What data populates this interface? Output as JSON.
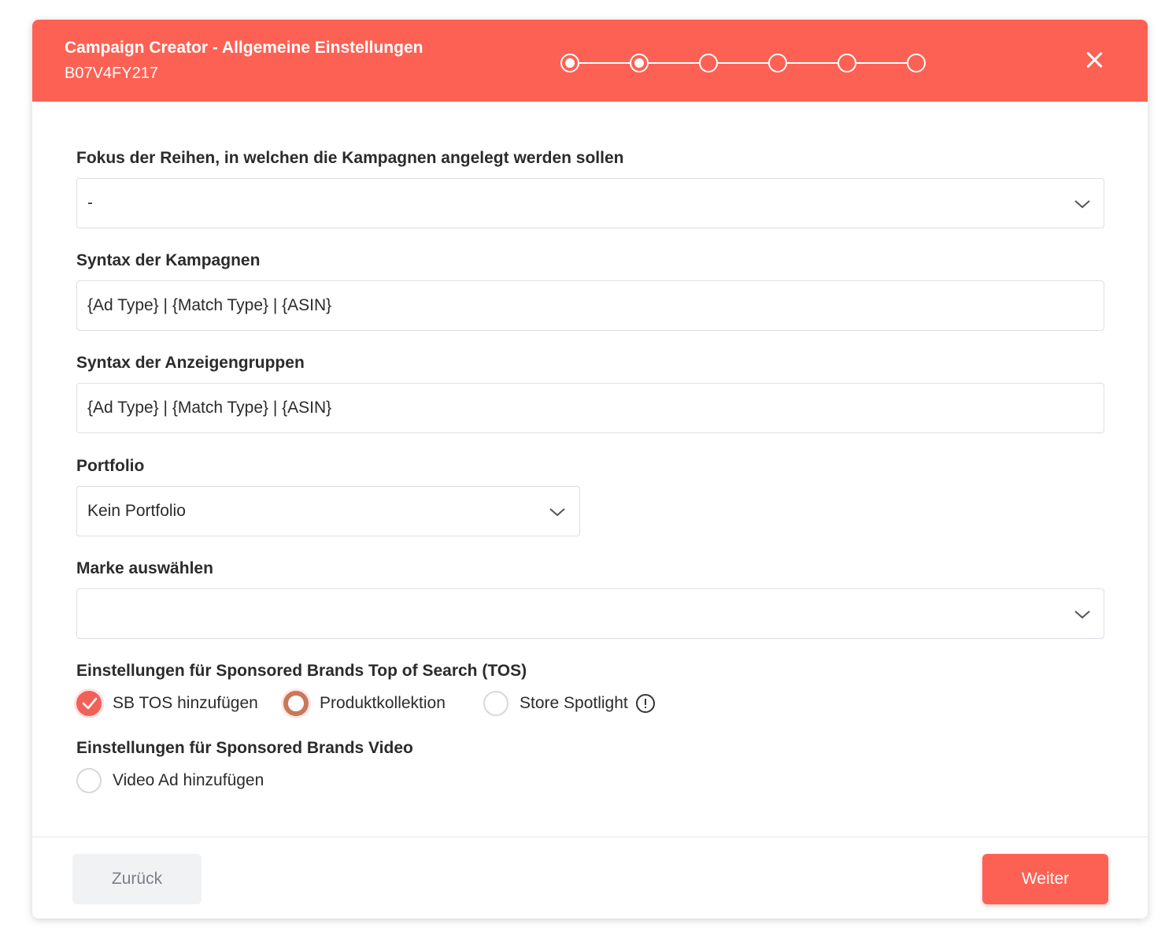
{
  "header": {
    "title": "Campaign Creator - Allgemeine Einstellungen",
    "subtitle": "B07V4FY217",
    "steps_total": 6,
    "steps_completed": 2
  },
  "form": {
    "focus": {
      "label": "Fokus der Reihen, in welchen die Kampagnen angelegt werden sollen",
      "value": "-"
    },
    "campaign_syntax": {
      "label": "Syntax der Kampagnen",
      "value": "{Ad Type} | {Match Type} | {ASIN}"
    },
    "adgroup_syntax": {
      "label": "Syntax der Anzeigengruppen",
      "value": "{Ad Type} | {Match Type} | {ASIN}"
    },
    "portfolio": {
      "label": "Portfolio",
      "value": "Kein Portfolio"
    },
    "brand": {
      "label": "Marke auswählen",
      "value": ""
    },
    "sb_tos": {
      "label": "Einstellungen für Sponsored Brands Top of Search (TOS)",
      "add_label": "SB TOS hinzufügen",
      "add_checked": true,
      "option_collection": "Produktkollektion",
      "option_spotlight": "Store Spotlight",
      "selected": "Produktkollektion"
    },
    "sb_video": {
      "label": "Einstellungen für Sponsored Brands Video",
      "add_label": "Video Ad hinzufügen",
      "add_checked": false
    }
  },
  "footer": {
    "back_label": "Zurück",
    "next_label": "Weiter"
  },
  "colors": {
    "brand": "#fd6154",
    "checkbox": "#f26158",
    "radio_selected": "#c9785a"
  }
}
